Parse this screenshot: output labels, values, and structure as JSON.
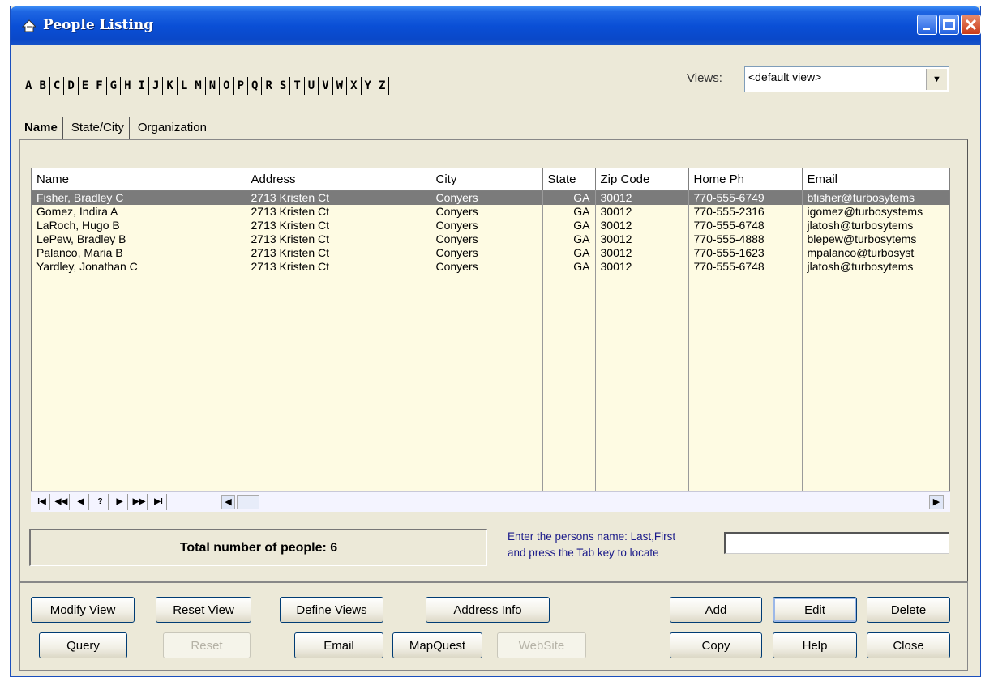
{
  "window": {
    "title": "People Listing"
  },
  "alphabet": [
    "A",
    "B",
    "C",
    "D",
    "E",
    "F",
    "G",
    "H",
    "I",
    "J",
    "K",
    "L",
    "M",
    "N",
    "O",
    "P",
    "Q",
    "R",
    "S",
    "T",
    "U",
    "V",
    "W",
    "X",
    "Y",
    "Z"
  ],
  "views": {
    "label": "Views:",
    "selected": "<default view>"
  },
  "tabs": [
    {
      "label": "Name",
      "active": true
    },
    {
      "label": "State/City",
      "active": false
    },
    {
      "label": "Organization",
      "active": false
    }
  ],
  "table": {
    "columns": [
      "Name",
      "Address",
      "City",
      "State",
      "Zip Code",
      "Home Ph",
      "Email"
    ],
    "rows": [
      [
        "Fisher, Bradley C",
        "2713 Kristen Ct",
        "Conyers",
        "GA",
        "30012",
        "770-555-6749",
        "bfisher@turbosytems"
      ],
      [
        "Gomez, Indira A",
        "2713 Kristen Ct",
        "Conyers",
        "GA",
        "30012",
        "770-555-2316",
        "igomez@turbosystems"
      ],
      [
        "LaRoch, Hugo B",
        "2713 Kristen Ct",
        "Conyers",
        "GA",
        "30012",
        "770-555-6748",
        "jlatosh@turbosytems"
      ],
      [
        "LePew, Bradley B",
        "2713 Kristen Ct",
        "Conyers",
        "GA",
        "30012",
        "770-555-4888",
        "blepew@turbosytems"
      ],
      [
        "Palanco, Maria B",
        "2713 Kristen Ct",
        "Conyers",
        "GA",
        "30012",
        "770-555-1623",
        "mpalanco@turbosyst"
      ],
      [
        "Yardley, Jonathan C",
        "2713 Kristen Ct",
        "Conyers",
        "GA",
        "30012",
        "770-555-6748",
        "jlatosh@turbosytems"
      ]
    ],
    "selected_row": 0
  },
  "navigator": {
    "first": "I◀",
    "prev_page": "◀◀",
    "prev": "◀",
    "help": "?",
    "next": "▶",
    "next_page": "▶▶",
    "last": "▶I"
  },
  "footer": {
    "total": "Total number of people: 6",
    "hint_line1": "Enter the persons name: Last,First",
    "hint_line2": "and press the Tab key to locate",
    "locate_value": ""
  },
  "buttons": {
    "modify_view": "Modify View",
    "reset_view": "Reset View",
    "define_views": "Define Views",
    "address_info": "Address Info",
    "add": "Add",
    "edit": "Edit",
    "delete": "Delete",
    "query": "Query",
    "reset": "Reset",
    "email": "Email",
    "mapquest": "MapQuest",
    "website": "WebSite",
    "copy": "Copy",
    "help": "Help",
    "close": "Close"
  }
}
